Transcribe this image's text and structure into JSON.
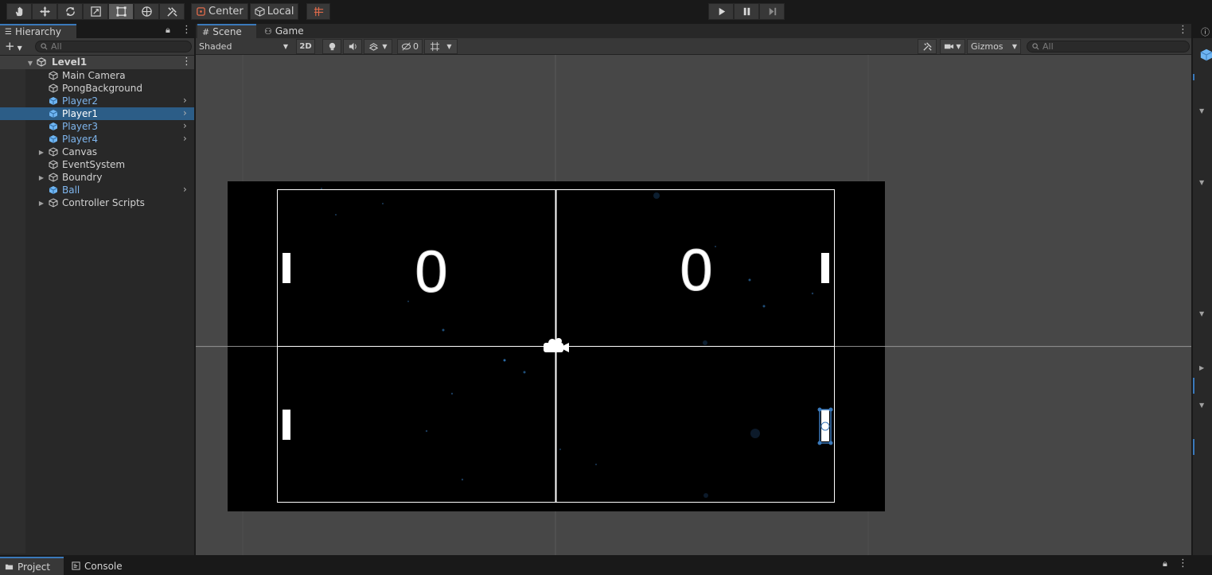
{
  "toolbar": {
    "tools": [
      {
        "name": "hand-tool-icon"
      },
      {
        "name": "move-tool-icon"
      },
      {
        "name": "rotate-tool-icon"
      },
      {
        "name": "scale-tool-icon"
      },
      {
        "name": "rect-tool-icon"
      },
      {
        "name": "transform-tool-icon"
      },
      {
        "name": "custom-tool-icon"
      }
    ],
    "pivot_mode": "Center",
    "pivot_rotation": "Local",
    "play_icons": [
      "play-icon",
      "pause-icon",
      "step-icon"
    ]
  },
  "hierarchy": {
    "tab_label": "Hierarchy",
    "search_placeholder": "All",
    "scene_name": "Level1",
    "items": [
      {
        "label": "Main Camera",
        "prefab": false,
        "foldout": false,
        "chevron": false,
        "selected": false
      },
      {
        "label": "PongBackground",
        "prefab": false,
        "foldout": false,
        "chevron": false,
        "selected": false
      },
      {
        "label": "Player2",
        "prefab": true,
        "foldout": false,
        "chevron": true,
        "selected": false
      },
      {
        "label": "Player1",
        "prefab": true,
        "foldout": false,
        "chevron": true,
        "selected": true
      },
      {
        "label": "Player3",
        "prefab": true,
        "foldout": false,
        "chevron": true,
        "selected": false
      },
      {
        "label": "Player4",
        "prefab": true,
        "foldout": false,
        "chevron": true,
        "selected": false
      },
      {
        "label": "Canvas",
        "prefab": false,
        "foldout": true,
        "chevron": false,
        "selected": false
      },
      {
        "label": "EventSystem",
        "prefab": false,
        "foldout": false,
        "chevron": false,
        "selected": false
      },
      {
        "label": "Boundry",
        "prefab": false,
        "foldout": true,
        "chevron": false,
        "selected": false
      },
      {
        "label": "Ball",
        "prefab": true,
        "foldout": false,
        "chevron": true,
        "selected": false
      },
      {
        "label": "Controller Scripts",
        "prefab": false,
        "foldout": true,
        "chevron": false,
        "selected": false
      }
    ]
  },
  "scene": {
    "tabs": [
      {
        "label": "Scene",
        "active": true
      },
      {
        "label": "Game",
        "active": false
      }
    ],
    "draw_mode": "Shaded",
    "mode_2d": "2D",
    "hidden_count": "0",
    "gizmos_label": "Gizmos",
    "search_placeholder": "All",
    "game_view": {
      "score_left": "0",
      "score_right": "0"
    }
  },
  "bottom": {
    "tabs": [
      {
        "label": "Project",
        "active": true
      },
      {
        "label": "Console",
        "active": false
      }
    ]
  },
  "colors": {
    "prefab_text": "#7fb6ee",
    "selection": "#2c5d87",
    "accent": "#3a79bb"
  }
}
